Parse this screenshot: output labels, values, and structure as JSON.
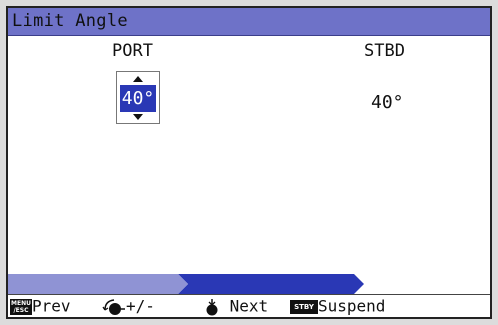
{
  "window": {
    "title": "Limit Angle"
  },
  "port": {
    "label": "PORT",
    "value": "40°"
  },
  "stbd": {
    "label": "STBD",
    "value": "40°"
  },
  "progress": {
    "steps_done": 1,
    "current_step": 2,
    "total_steps": 3
  },
  "footer": {
    "menu_key": "MENU/ESC",
    "prev_label": "Prev",
    "adjust_label": "+/-",
    "next_label": "Next",
    "stby_key": "STBY",
    "suspend_label": "Suspend"
  },
  "icons": [
    "menu-esc-key-icon",
    "rotary-knob-icon",
    "knob-push-icon",
    "stby-key-icon",
    "spin-up-icon",
    "spin-down-icon"
  ],
  "colors": {
    "title_bar": "#6e72c8",
    "selection": "#2a38b5",
    "progress_done": "#8f93d4",
    "progress_current": "#2a38b5"
  }
}
